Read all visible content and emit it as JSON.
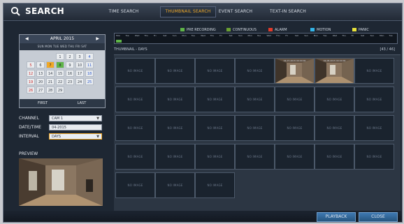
{
  "header": {
    "title": "SEARCH",
    "tabs": [
      {
        "label": "TIME SEARCH",
        "active": false
      },
      {
        "label": "THUMBNAIL SEARCH",
        "active": true
      },
      {
        "label": "EVENT SEARCH",
        "active": false
      },
      {
        "label": "TEXT-IN SEARCH",
        "active": false
      }
    ]
  },
  "calendar": {
    "month_label": "APRIL 2015",
    "prev_icon": "triangle-left",
    "next_icon": "triangle-right",
    "weekdays": "SUN  MON  TUE  WED  THU  FRI  SAT",
    "rows": [
      [
        "",
        "",
        "",
        "1",
        "2",
        "3",
        "4"
      ],
      [
        "5",
        "6",
        "7",
        "8",
        "9",
        "10",
        "11"
      ],
      [
        "12",
        "13",
        "14",
        "15",
        "16",
        "17",
        "18"
      ],
      [
        "19",
        "20",
        "21",
        "22",
        "23",
        "24",
        "25"
      ],
      [
        "26",
        "27",
        "28",
        "29",
        "",
        "",
        ""
      ]
    ],
    "recorded_days": [
      "7"
    ],
    "selected_day": "8",
    "first_label": "FIRST",
    "last_label": "LAST"
  },
  "fields": {
    "channel_label": "CHANNEL",
    "channel_value": "CAM 1",
    "datetime_label": "DATE/TIME",
    "datetime_value": "04-2015",
    "interval_label": "INTERVAL",
    "interval_value": "DAYS"
  },
  "preview": {
    "label": "PREVIEW"
  },
  "legend": [
    {
      "label": "PRE RECORDING",
      "color": "#5fb548"
    },
    {
      "label": "CONTINUOUS",
      "color": "#6aa032"
    },
    {
      "label": "ALARM",
      "color": "#e23a2a"
    },
    {
      "label": "MOTION",
      "color": "#33b5e8"
    },
    {
      "label": "PANIC",
      "color": "#e8e23a"
    }
  ],
  "timeline": {
    "labels": [
      "Mon",
      "Tue",
      "Wed",
      "Thu",
      "Fri",
      "Sat",
      "Sun",
      "Mon",
      "Tue",
      "Wed",
      "Thu",
      "Fri",
      "Sat",
      "Sun",
      "Mon",
      "Tue",
      "Wed",
      "Thu",
      "Fri",
      "Sat",
      "Sun",
      "Mon",
      "Tue",
      "Wed",
      "Thu",
      "Fri",
      "Sat",
      "Sun",
      "Mon",
      "Tue"
    ]
  },
  "grid": {
    "title": "THUMBNAIL - DAYS",
    "page": "[43 / 46]",
    "no_image_label": "NO IMAGE",
    "thumbs": [
      {
        "caption": "",
        "image": false
      },
      {
        "caption": "",
        "image": false
      },
      {
        "caption": "",
        "image": false
      },
      {
        "caption": "",
        "image": false
      },
      {
        "caption": "04-07-2015 00:00:00",
        "image": true
      },
      {
        "caption": "04-08-2015 00:00:00",
        "image": true
      },
      {
        "caption": "",
        "image": false
      },
      {
        "caption": "",
        "image": false
      },
      {
        "caption": "",
        "image": false
      },
      {
        "caption": "",
        "image": false
      },
      {
        "caption": "",
        "image": false
      },
      {
        "caption": "",
        "image": false
      },
      {
        "caption": "",
        "image": false
      },
      {
        "caption": "",
        "image": false
      },
      {
        "caption": "",
        "image": false
      },
      {
        "caption": "",
        "image": false
      },
      {
        "caption": "",
        "image": false
      },
      {
        "caption": "",
        "image": false
      },
      {
        "caption": "",
        "image": false
      },
      {
        "caption": "",
        "image": false
      },
      {
        "caption": "",
        "image": false
      },
      {
        "caption": "",
        "image": false
      },
      {
        "caption": "",
        "image": false
      },
      {
        "caption": "",
        "image": false
      },
      {
        "caption": "",
        "image": false
      },
      {
        "caption": "",
        "image": false
      },
      {
        "caption": "",
        "image": false
      },
      {
        "caption": "",
        "image": false
      },
      {
        "caption": "",
        "image": false
      },
      {
        "caption": "",
        "image": false
      },
      {
        "caption": "",
        "image": false
      }
    ]
  },
  "footer": {
    "playback_label": "PLAYBACK",
    "close_label": "CLOSE"
  }
}
